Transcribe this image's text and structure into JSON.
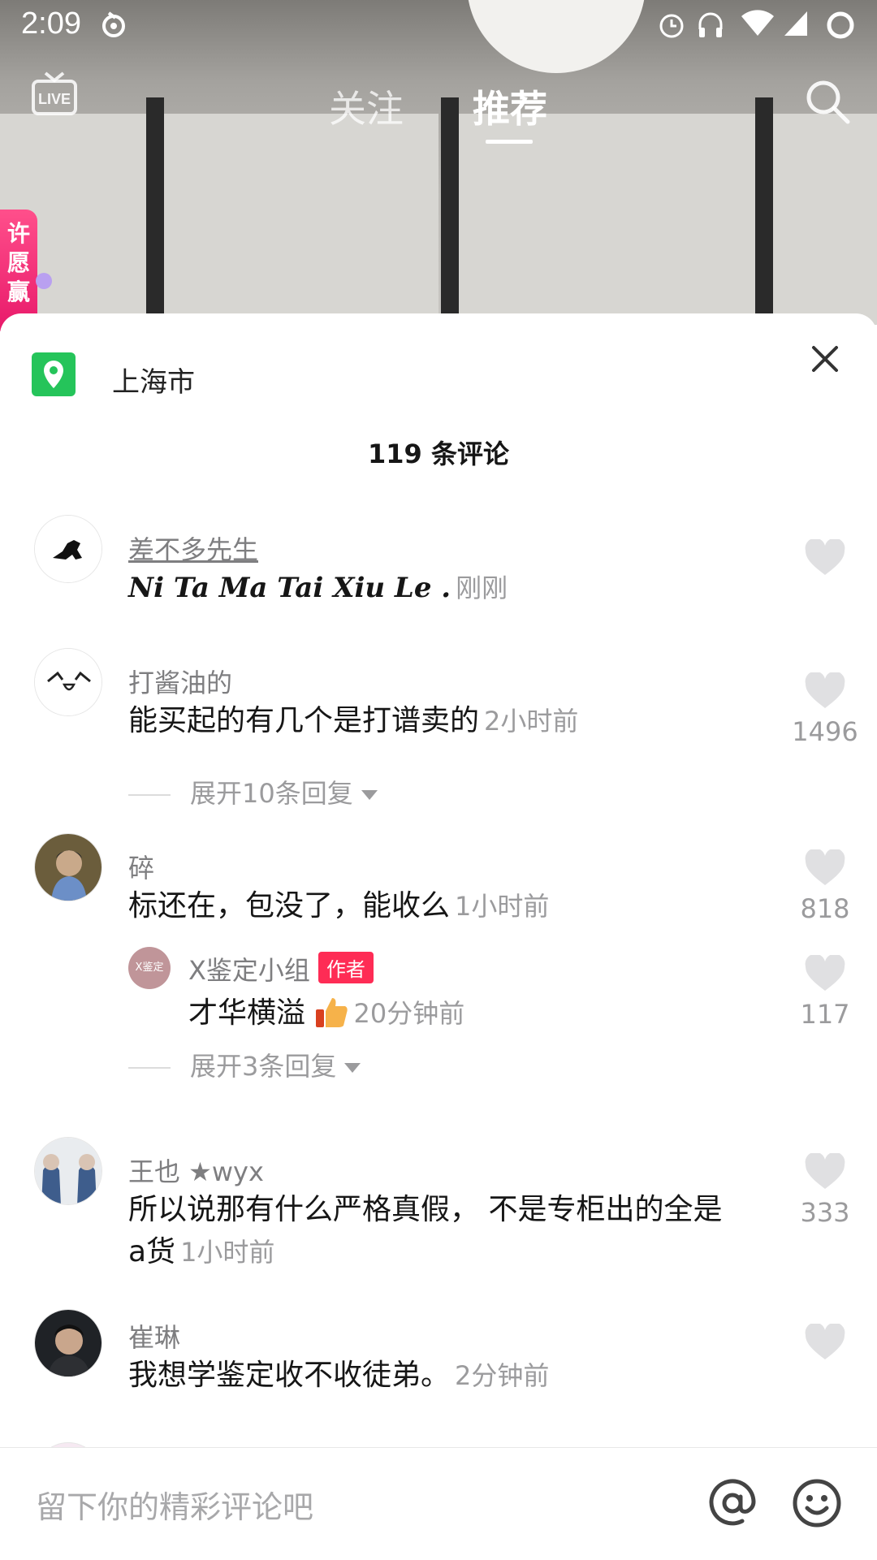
{
  "status_bar": {
    "time": "2:09"
  },
  "top_nav": {
    "follow_tab": "关注",
    "recommend_tab": "推荐",
    "live_label": "LIVE"
  },
  "side_badge": {
    "text": "许愿赢"
  },
  "sheet": {
    "location": "上海市",
    "comment_count_title": "119 条评论",
    "comments": [
      {
        "username": "差不多先生",
        "text": "Ni Ta Ma Tai Xiu Le .",
        "time": "刚刚",
        "likes": ""
      },
      {
        "username": "打酱油的",
        "text": "能买起的有几个是打谱卖的",
        "time": "2小时前",
        "likes": "1496",
        "expand": "展开10条回复"
      },
      {
        "username": "碎",
        "text": "标还在，包没了，能收么",
        "time": "1小时前",
        "likes": "818",
        "reply": {
          "avatar_text": "X鉴定",
          "username": "X鉴定小组",
          "tag": "作者",
          "text": "才华横溢",
          "time": "20分钟前",
          "likes": "117"
        },
        "expand": "展开3条回复"
      },
      {
        "username": "王也 ★wyx",
        "text": "所以说那有什么严格真假， 不是专柜出的全是a货",
        "text_line1": "所以说那有什么严格真假， 不是专柜出的全是",
        "text_line2": "a货",
        "time": "1小时前",
        "likes": "333"
      },
      {
        "username": "崔琳",
        "text": "我想学鉴定收不收徒弟。",
        "time": "2分钟前",
        "likes": ""
      }
    ]
  },
  "input_bar": {
    "placeholder": "留下你的精彩评论吧"
  },
  "colors": {
    "accent": "#fe2c55",
    "location_green": "#25c45a",
    "secondary_text": "#9b9b9d"
  },
  "icons": [
    "live-icon",
    "search-icon",
    "location-icon",
    "close-icon",
    "heart-icon",
    "at-icon",
    "emoji-icon",
    "thumbs-up-icon"
  ]
}
